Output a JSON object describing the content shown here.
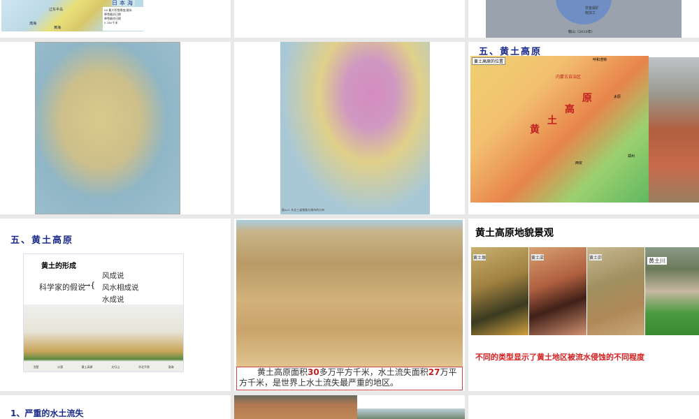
{
  "slides": [
    {
      "id": 1,
      "map_labels": [
        "渤海",
        "黄海",
        "辽东半岛",
        "日本海"
      ],
      "legend": [
        "58 最大积雪厚度/厘米",
        "降雪最初日期",
        "降雪最终日期",
        "0 140千米"
      ]
    },
    {
      "id": 2
    },
    {
      "id": 3,
      "pie_labels": [
        "非金属矿物加工"
      ],
      "caption": "鞍山（2010年）"
    },
    {
      "id": 4
    },
    {
      "id": 5,
      "caption": "图A21 东北三省铁路与城市的分布"
    },
    {
      "id": 6,
      "title": "五、黄土高原",
      "map_label": "黄土高原的位置",
      "map_words": [
        "黄",
        "土",
        "高",
        "原",
        "内蒙古自治区",
        "呼和浩特",
        "太原",
        "西安",
        "郑州"
      ]
    },
    {
      "id": 7,
      "title": "五、黄土高原",
      "box_title": "黄土的形成",
      "hypothesis_label": "科学家的假说",
      "hypotheses": [
        "风成说",
        "风水相成说",
        "水成说"
      ],
      "diagram_labels": [
        "戈壁",
        "沙漠",
        "黄土高原",
        "太行山",
        "华北平原",
        "渤海"
      ]
    },
    {
      "id": 8,
      "caption_parts": [
        "黄土高原面积",
        "30",
        "多万平方千米，水土流失面积",
        "27",
        "万平方千米，是世界上水土流失最严重的地区。"
      ]
    },
    {
      "id": 9,
      "title": "黄土高原地貌景观",
      "photo_labels": [
        "黄土塬",
        "黄土梁",
        "黄土峁",
        "黄土川"
      ],
      "note": "不同的类型显示了黄土地区被流水侵蚀的不同程度"
    },
    {
      "id": 10,
      "title": "1、严重的水土流失"
    },
    {
      "id": 11
    },
    {
      "id": 12
    }
  ],
  "colors": {
    "background": "#e8e8e8",
    "title_blue": "#1a2a8a",
    "red_text": "#d42020"
  }
}
